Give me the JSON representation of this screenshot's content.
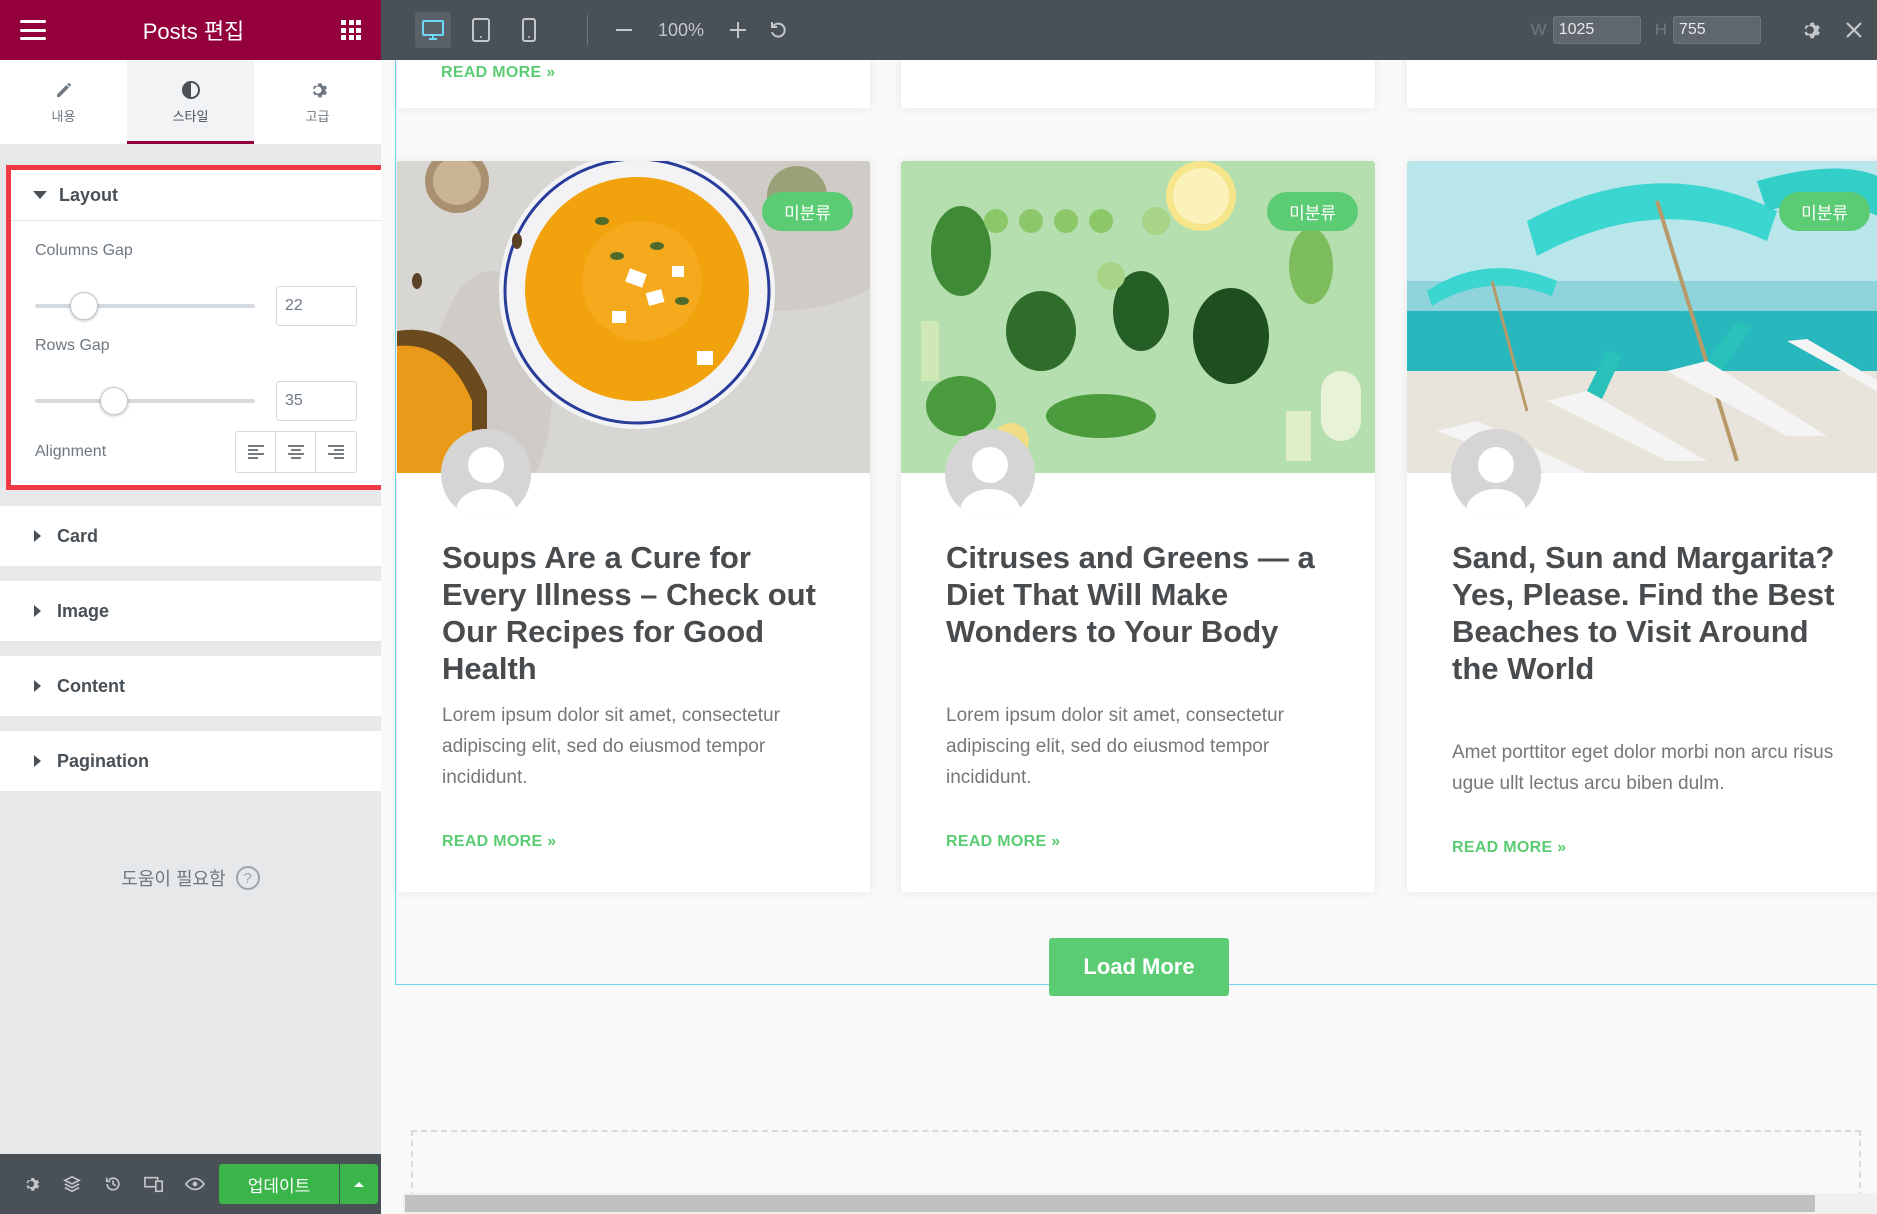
{
  "sidebar": {
    "title": "Posts 편집",
    "tabs": [
      {
        "label": "내용",
        "icon": "pencil-icon"
      },
      {
        "label": "스타일",
        "icon": "half-circle-icon"
      },
      {
        "label": "고급",
        "icon": "gear-icon"
      }
    ],
    "layout": {
      "title": "Layout",
      "columns_gap_label": "Columns Gap",
      "columns_gap_value": "22",
      "rows_gap_label": "Rows Gap",
      "rows_gap_value": "35",
      "alignment_label": "Alignment"
    },
    "sections": [
      "Card",
      "Image",
      "Content",
      "Pagination"
    ],
    "help_text": "도움이 필요함",
    "help_icon": "?",
    "footer": {
      "update_label": "업데이트"
    }
  },
  "toolbar": {
    "zoom": "100%",
    "width_label": "W",
    "width_value": "1025",
    "height_label": "H",
    "height_value": "755"
  },
  "preview": {
    "top_read_more": "READ MORE »",
    "cards": [
      {
        "badge": "미분류",
        "title": "Soups Are a Cure for Every Illness – Check out Our Recipes for Good Health",
        "excerpt": "Lorem ipsum dolor sit amet, consectetur adipiscing elit, sed do eiusmod tempor incididunt.",
        "read_more": "READ MORE »"
      },
      {
        "badge": "미분류",
        "title": "Citruses and Greens — a Diet That Will Make Wonders to Your Body",
        "excerpt": "Lorem ipsum dolor sit amet, consectetur adipiscing elit, sed do eiusmod tempor incididunt.",
        "read_more": "READ MORE »"
      },
      {
        "badge": "미분류",
        "title": "Sand, Sun and Margarita? Yes, Please. Find the Best Beaches to Visit Around the World",
        "excerpt": "Amet porttitor eget dolor morbi non arcu risus ugue ullt lectus arcu biben dulm.",
        "read_more": "READ MORE »"
      }
    ],
    "load_more": "Load More"
  },
  "colors": {
    "brand": "#93003c",
    "accent_green": "#5ccc74",
    "update_green": "#39b54a",
    "highlight_red": "#ef3a44",
    "toolbar_bg": "#495157"
  }
}
